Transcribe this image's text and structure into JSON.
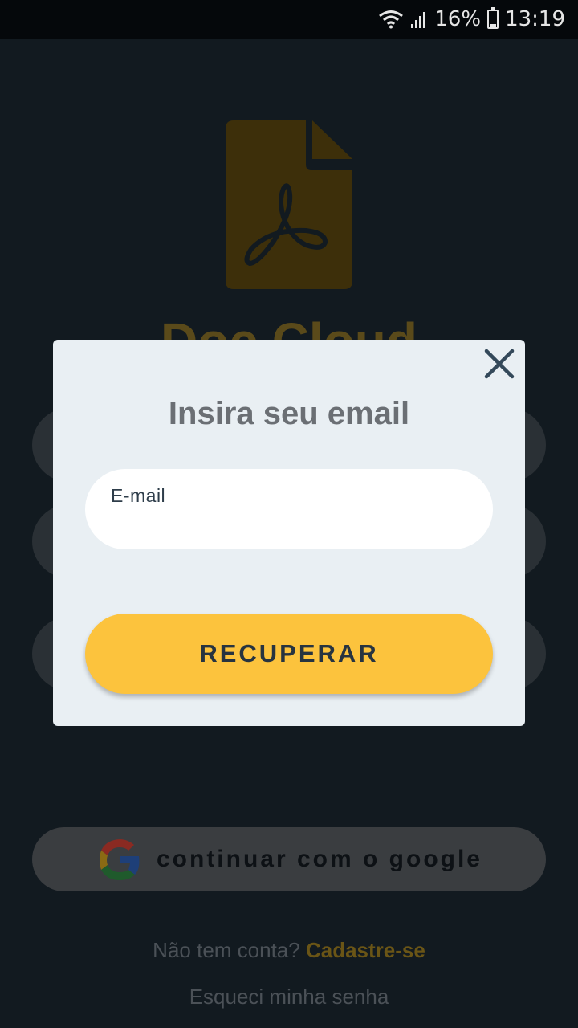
{
  "status_bar": {
    "battery": "16%",
    "time": "13:19",
    "icons": [
      "wifi-icon",
      "signal-icon",
      "battery-icon"
    ]
  },
  "app": {
    "title": "Doc Cloud",
    "google_button_label": "continuar com o google",
    "signup_prompt": "Não tem conta?",
    "signup_link": "Cadastre-se",
    "forgot_password": "Esqueci minha senha",
    "colors": {
      "accent": "#fcc33d",
      "background": "#121a20"
    }
  },
  "modal": {
    "title": "Insira seu email",
    "email_label": "E-mail",
    "email_value": "",
    "recover_button": "RECUPERAR",
    "close_icon": "close-icon",
    "colors": {
      "background": "#e9eff3",
      "button": "#fcc33d",
      "text": "#273440"
    }
  }
}
